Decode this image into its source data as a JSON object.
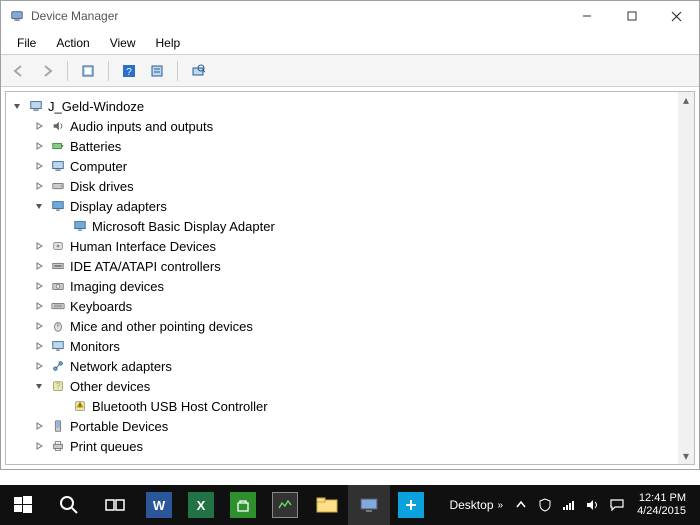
{
  "window": {
    "title": "Device Manager"
  },
  "menubar": [
    "File",
    "Action",
    "View",
    "Help"
  ],
  "tree": {
    "root": "J_Geld-Windoze",
    "items": [
      {
        "label": "Audio inputs and outputs",
        "icon": "audio"
      },
      {
        "label": "Batteries",
        "icon": "battery"
      },
      {
        "label": "Computer",
        "icon": "computer"
      },
      {
        "label": "Disk drives",
        "icon": "disk"
      },
      {
        "label": "Display adapters",
        "icon": "display",
        "expanded": true,
        "children": [
          {
            "label": "Microsoft Basic Display Adapter",
            "icon": "display"
          }
        ]
      },
      {
        "label": "Human Interface Devices",
        "icon": "hid"
      },
      {
        "label": "IDE ATA/ATAPI controllers",
        "icon": "ide"
      },
      {
        "label": "Imaging devices",
        "icon": "imaging"
      },
      {
        "label": "Keyboards",
        "icon": "keyboard"
      },
      {
        "label": "Mice and other pointing devices",
        "icon": "mouse"
      },
      {
        "label": "Monitors",
        "icon": "monitor"
      },
      {
        "label": "Network adapters",
        "icon": "network"
      },
      {
        "label": "Other devices",
        "icon": "other",
        "expanded": true,
        "children": [
          {
            "label": "Bluetooth USB Host Controller",
            "icon": "warn"
          }
        ]
      },
      {
        "label": "Portable Devices",
        "icon": "portable"
      },
      {
        "label": "Print queues",
        "icon": "print"
      }
    ]
  },
  "taskbar": {
    "desktop_label": "Desktop",
    "clock": {
      "time": "12:41 PM",
      "date": "4/24/2015"
    }
  }
}
